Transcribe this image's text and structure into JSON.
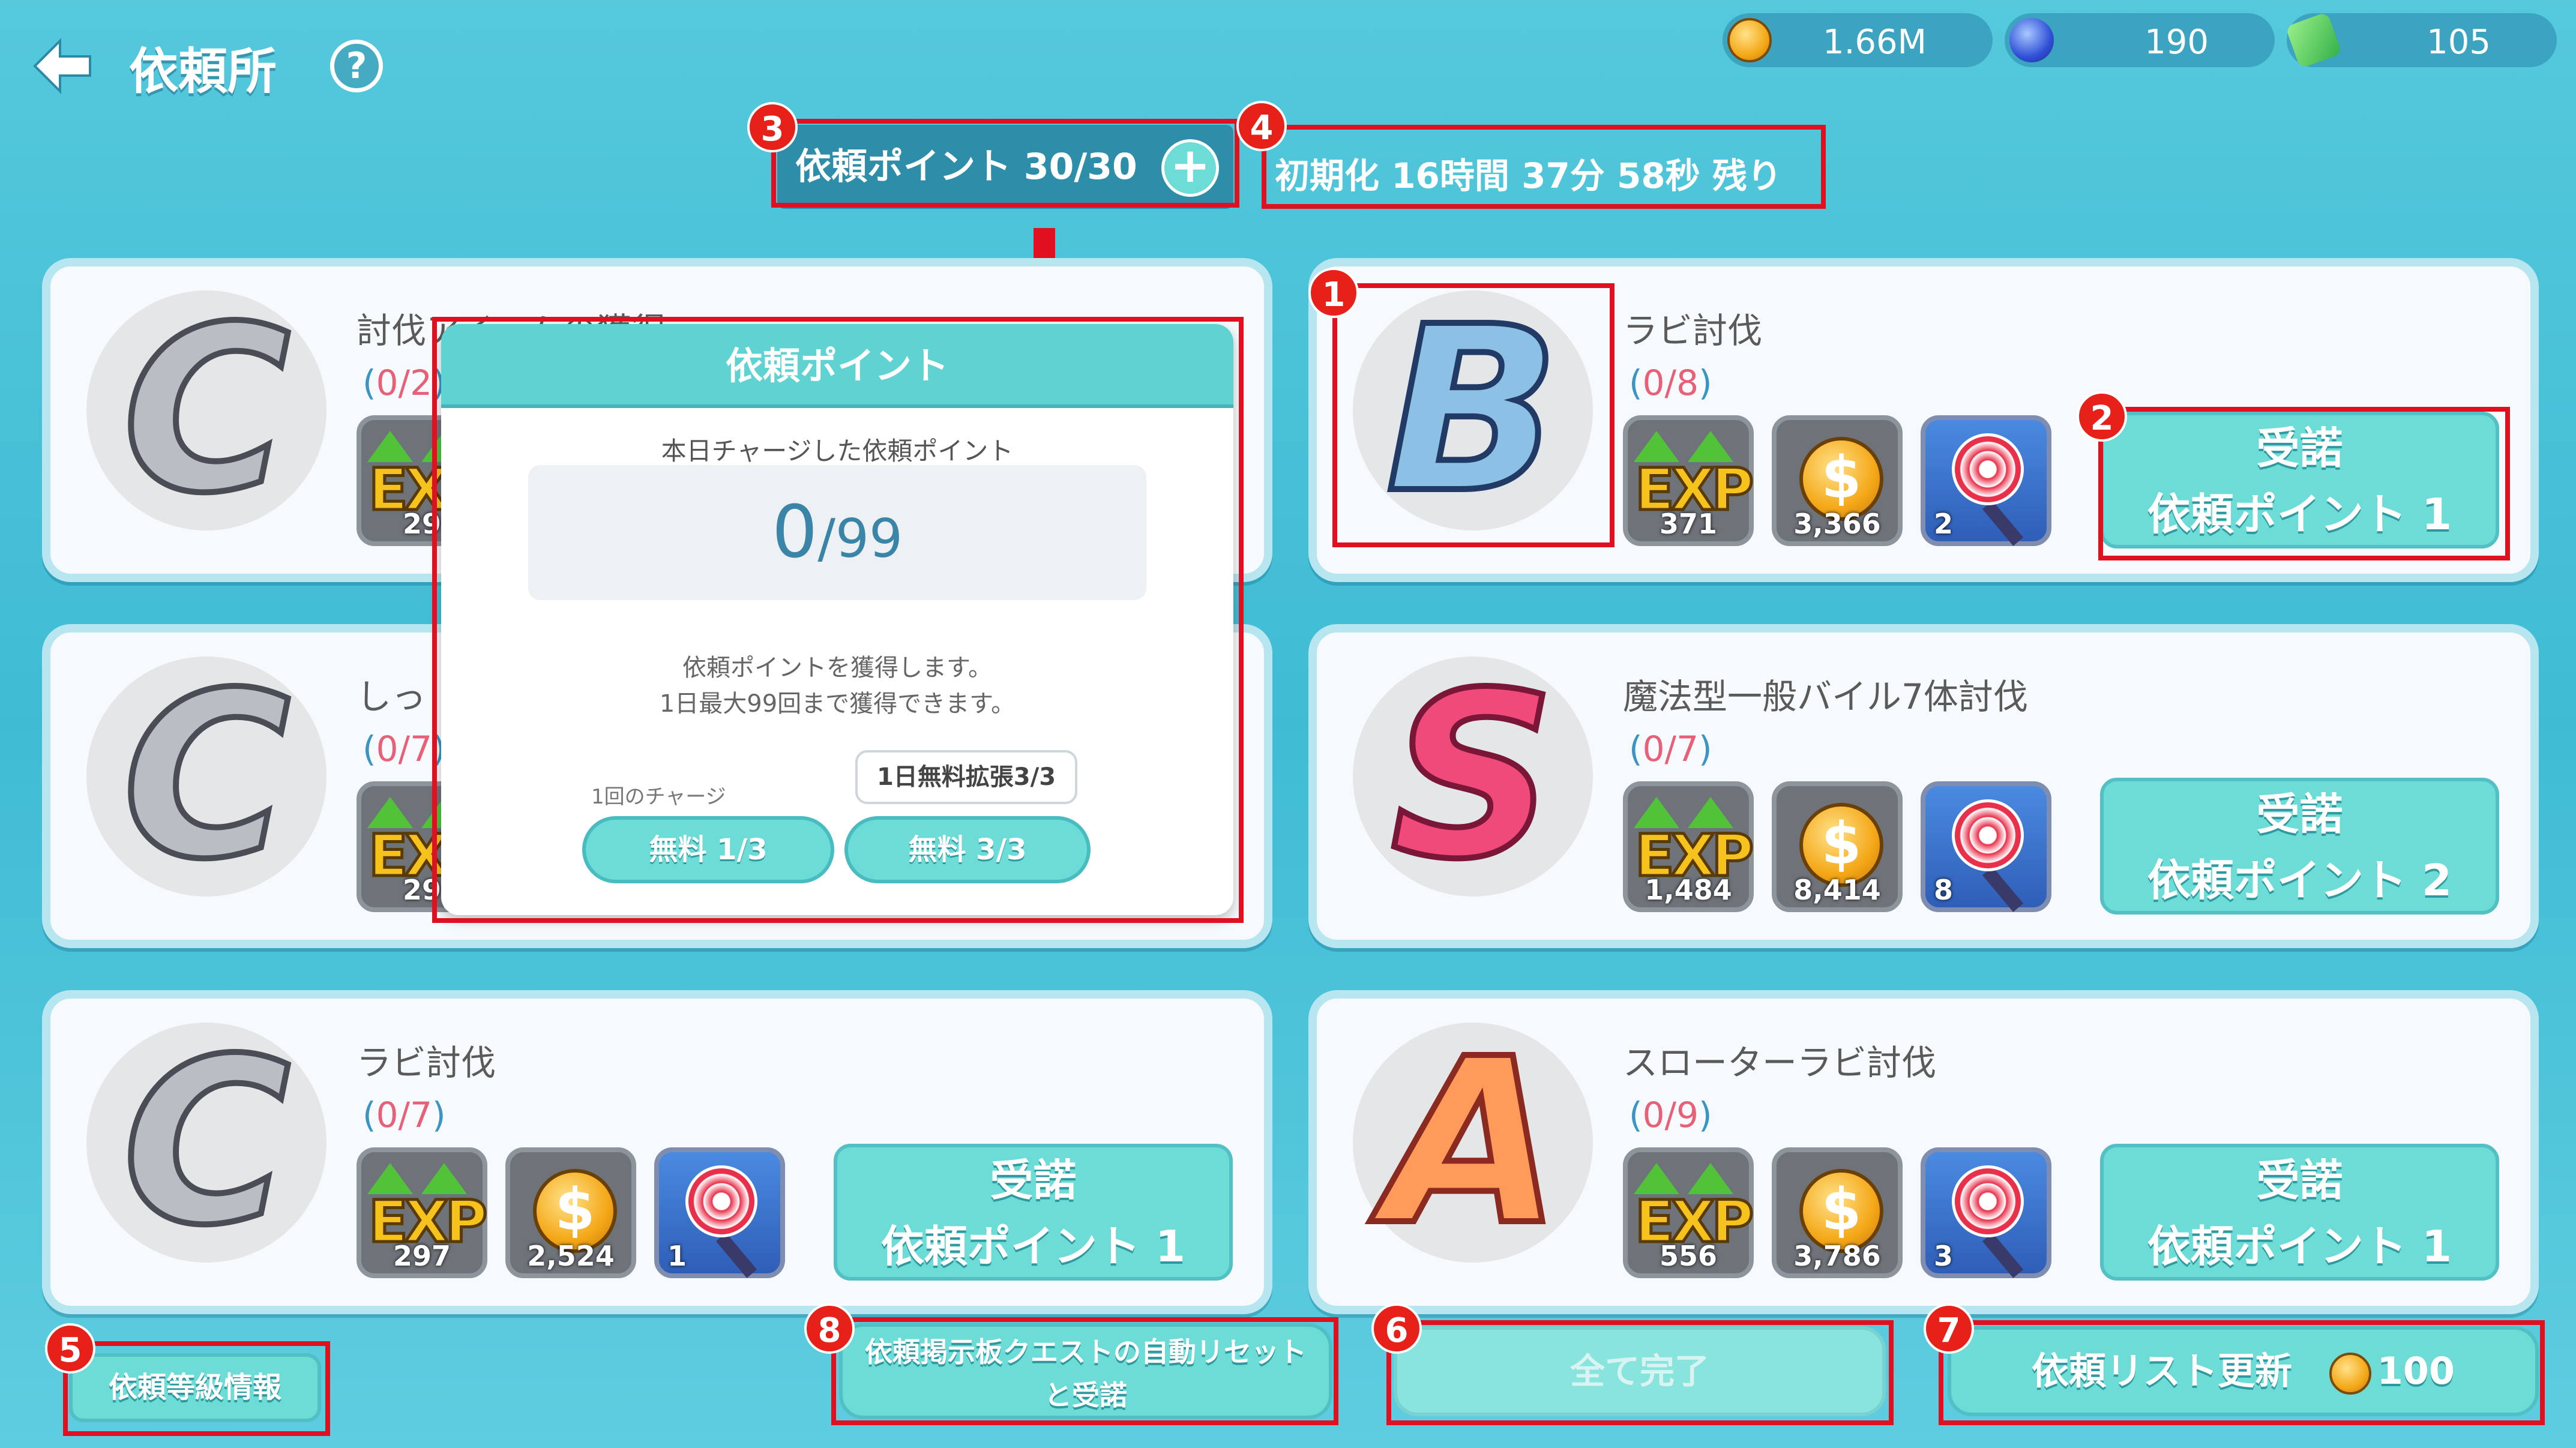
{
  "header": {
    "title": "依頼所",
    "help_label": "?"
  },
  "currencies": [
    {
      "name": "gold-coin",
      "value": "1.66M"
    },
    {
      "name": "blue-gem",
      "value": "190"
    },
    {
      "name": "green-ticket",
      "value": "105"
    }
  ],
  "request_points": {
    "label": "依頼ポイント 30/30",
    "plus": "+"
  },
  "reset_timer": "初期化 16時間 37分 58秒 残り",
  "markers": [
    "1",
    "2",
    "3",
    "4",
    "5",
    "6",
    "7",
    "8"
  ],
  "quests": [
    {
      "rank": "C",
      "name": "討伐アイテムの獲得",
      "progress_open": "(",
      "progress_value": "0/2",
      "progress_close": ")",
      "exp": "29"
    },
    {
      "rank": "B",
      "name": "ラビ討伐",
      "progress_open": "(",
      "progress_value": "0/8",
      "progress_close": ")",
      "exp": "371",
      "coins": "3,366",
      "candy": "2",
      "accept_line1": "受諾",
      "accept_line2": "依頼ポイント 1"
    },
    {
      "rank": "C",
      "name": "しっ",
      "progress_open": "(",
      "progress_value": "0/7",
      "progress_close": ")",
      "exp": "29"
    },
    {
      "rank": "S",
      "name": "魔法型一般バイル7体討伐",
      "progress_open": "(",
      "progress_value": "0/7",
      "progress_close": ")",
      "exp": "1,484",
      "coins": "8,414",
      "candy": "8",
      "accept_line1": "受諾",
      "accept_line2": "依頼ポイント 2"
    },
    {
      "rank": "C",
      "name": "ラビ討伐",
      "progress_open": "(",
      "progress_value": "0/7",
      "progress_close": ")",
      "exp": "297",
      "coins": "2,524",
      "candy": "1",
      "accept_line1": "受諾",
      "accept_line2": "依頼ポイント 1"
    },
    {
      "rank": "A",
      "name": "スローターラビ討伐",
      "progress_open": "(",
      "progress_value": "0/9",
      "progress_close": ")",
      "exp": "556",
      "coins": "3,786",
      "candy": "3",
      "accept_line1": "受諾",
      "accept_line2": "依頼ポイント 1"
    }
  ],
  "item_labels": {
    "exp": "EXP",
    "coin": "$"
  },
  "popup": {
    "title": "依頼ポイント",
    "charged_label": "本日チャージした依頼ポイント",
    "charged_value": "0",
    "charged_max": "/99",
    "desc_line1": "依頼ポイントを獲得します。",
    "desc_line2": "1日最大99回まで獲得できます。",
    "charge_once_label": "1回のチャージ",
    "daily_tooltip": "1日無料拡張3/3",
    "free_button_1": "無料 1/3",
    "free_button_2": "無料 3/3"
  },
  "bottom": {
    "rank_info": "依頼等級情報",
    "auto_reset_line1": "依頼掲示板クエストの自動リセット",
    "auto_reset_line2": "と受諾",
    "complete_all": "全て完了",
    "refresh_label": "依頼リスト更新",
    "refresh_cost": "100"
  },
  "colors": {
    "background": "#44c0d6",
    "button": "#6ddcd6",
    "annotation_red": "#e01020",
    "progress_pink": "#e86078"
  }
}
